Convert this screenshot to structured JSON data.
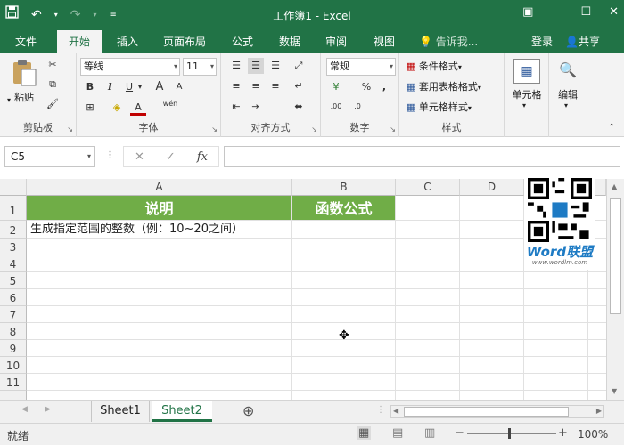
{
  "title_bar": {
    "title": "工作簿1 - Excel"
  },
  "tabs": {
    "file": "文件",
    "home": "开始",
    "insert": "插入",
    "page_layout": "页面布局",
    "formulas": "公式",
    "data": "数据",
    "review": "审阅",
    "view": "视图",
    "tell_me": "告诉我...",
    "login": "登录",
    "share": "共享"
  },
  "ribbon": {
    "clipboard": {
      "paste": "粘贴",
      "label": "剪贴板"
    },
    "font": {
      "name": "等线",
      "size": "11",
      "bold": "B",
      "italic": "I",
      "underline": "U",
      "grow": "A",
      "shrink": "A",
      "wen": "wén",
      "font_color": "A",
      "label": "字体"
    },
    "alignment": {
      "label": "对齐方式"
    },
    "number": {
      "format": "常规",
      "percent": "%",
      "comma": ",",
      "label": "数字"
    },
    "styles": {
      "conditional": "条件格式",
      "table": "套用表格格式",
      "cell_styles": "单元格样式",
      "label": "样式"
    },
    "cells": {
      "label": "单元格"
    },
    "editing": {
      "label": "编辑"
    }
  },
  "formula_bar": {
    "name_box": "C5",
    "cancel": "✕",
    "enter": "✓",
    "fx": "fx",
    "formula": ""
  },
  "grid": {
    "columns": [
      "A",
      "B",
      "C",
      "D"
    ],
    "rows": [
      "1",
      "2",
      "3",
      "4",
      "5",
      "6",
      "7",
      "8",
      "9",
      "10",
      "11"
    ],
    "a1": "说明",
    "b1": "函数公式",
    "a2": "生成指定范围的整数（例：10~20之间）"
  },
  "sheets": {
    "sheet1": "Sheet1",
    "sheet2": "Sheet2",
    "add": "⊕"
  },
  "status": {
    "ready": "就绪",
    "zoom": "100%"
  },
  "watermark": {
    "brand": "Word联盟",
    "site": "www.wordlm.com"
  },
  "colors": {
    "excel_green": "#217346",
    "header_green": "#70ad47"
  }
}
